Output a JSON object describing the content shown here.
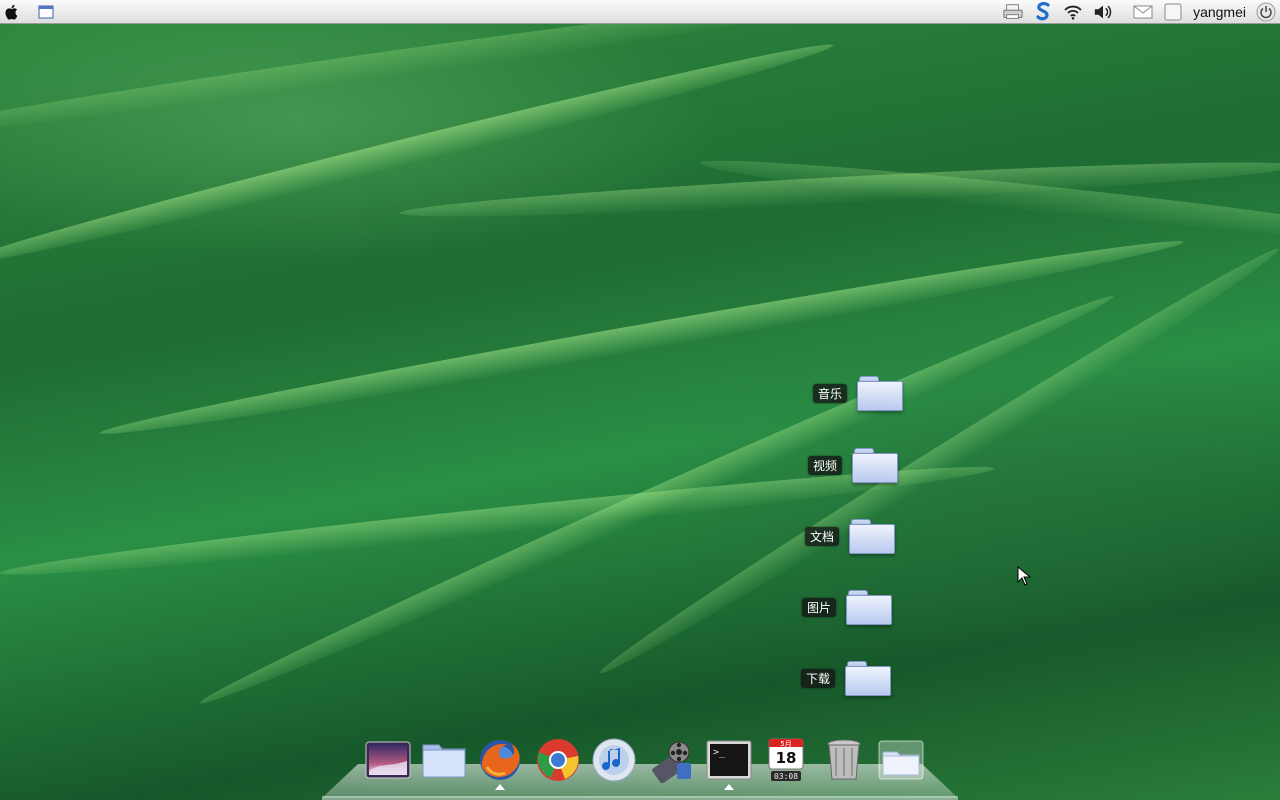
{
  "top_panel": {
    "left_icons": [
      "apple-menu-icon",
      "show-desktop-icon"
    ],
    "right_icons": [
      "printer-icon",
      "update-s-icon",
      "wifi-icon",
      "volume-icon",
      "mail-icon",
      "window-list-icon"
    ],
    "username": "yangmei",
    "power_icon": "power-icon"
  },
  "desktop_folders": [
    {
      "label": "音乐",
      "icon": "folder-icon"
    },
    {
      "label": "视频",
      "icon": "folder-icon"
    },
    {
      "label": "文档",
      "icon": "folder-icon"
    },
    {
      "label": "图片",
      "icon": "folder-icon"
    },
    {
      "label": "下载",
      "icon": "folder-icon"
    }
  ],
  "dock": {
    "items": [
      {
        "name": "photo-viewer-icon"
      },
      {
        "name": "home-folder-icon"
      },
      {
        "name": "firefox-icon",
        "running": true
      },
      {
        "name": "chrome-icon"
      },
      {
        "name": "music-player-icon"
      },
      {
        "name": "video-player-icon"
      },
      {
        "name": "terminal-icon",
        "running": true
      },
      {
        "name": "calendar-icon"
      },
      {
        "name": "trash-icon"
      },
      {
        "name": "stack-folder-icon"
      }
    ],
    "calendar": {
      "month": "5月",
      "day": "18",
      "time": "03:08"
    },
    "terminal_prompt": ">_"
  },
  "colors": {
    "panel_top": "#fbfbfb",
    "panel_bottom": "#dedede",
    "wallpaper_green": "#2a8f45",
    "label_bg": "#141414"
  }
}
